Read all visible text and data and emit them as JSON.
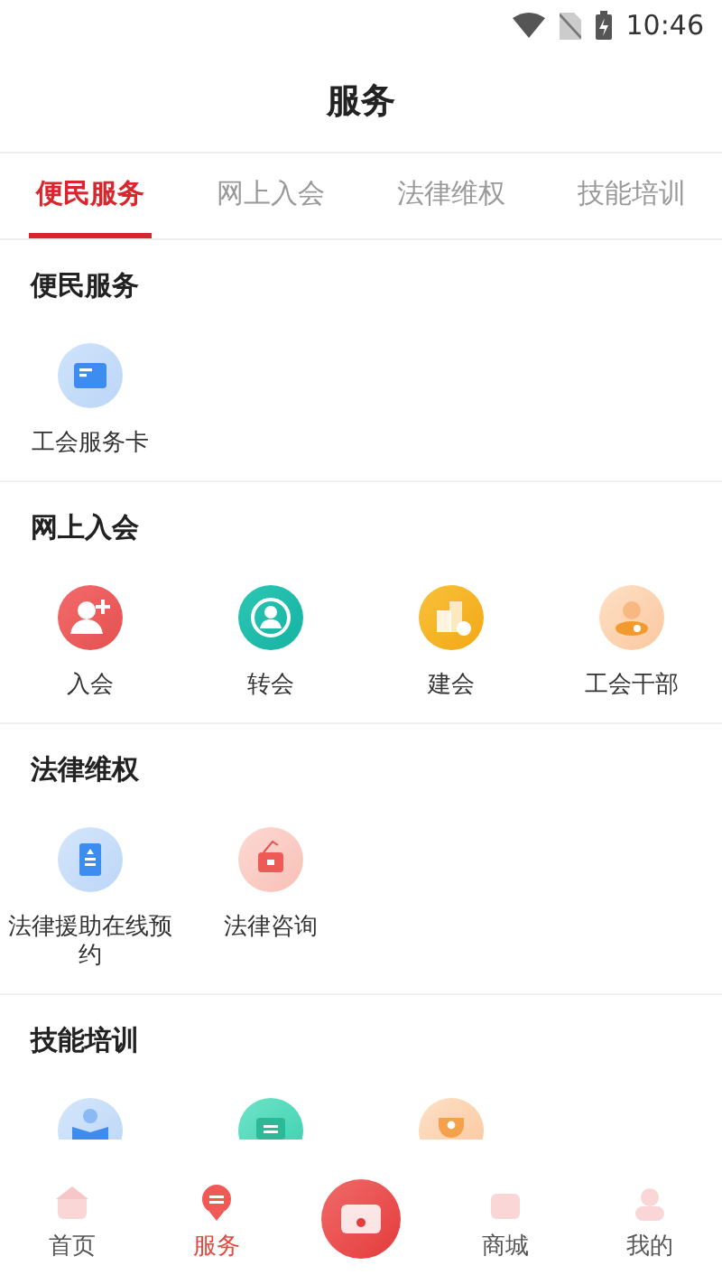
{
  "status_bar": {
    "time": "10:46"
  },
  "header": {
    "title": "服务"
  },
  "tabs": [
    {
      "label": "便民服务",
      "selected": true
    },
    {
      "label": "网上入会",
      "selected": false
    },
    {
      "label": "法律维权",
      "selected": false
    },
    {
      "label": "技能培训",
      "selected": false
    }
  ],
  "sections": [
    {
      "title": "便民服务",
      "items": [
        {
          "label": "工会服务卡",
          "kind": "card"
        }
      ]
    },
    {
      "title": "网上入会",
      "items": [
        {
          "label": "入会",
          "kind": "join"
        },
        {
          "label": "转会",
          "kind": "transfer"
        },
        {
          "label": "建会",
          "kind": "building"
        },
        {
          "label": "工会干部",
          "kind": "cadre"
        }
      ]
    },
    {
      "title": "法律维权",
      "items": [
        {
          "label": "法律援助在线预约",
          "kind": "document"
        },
        {
          "label": "法律咨询",
          "kind": "sign"
        }
      ]
    },
    {
      "title": "技能培训",
      "items": [
        {
          "kind": "reader"
        },
        {
          "kind": "board"
        },
        {
          "kind": "trophy"
        }
      ]
    }
  ],
  "bottom_nav": [
    {
      "label": "首页",
      "kind": "tab",
      "selected": false
    },
    {
      "label": "服务",
      "kind": "tab",
      "selected": true
    },
    {
      "kind": "center"
    },
    {
      "label": "商城",
      "kind": "tab",
      "selected": false
    },
    {
      "label": "我的",
      "kind": "tab",
      "selected": false
    }
  ]
}
